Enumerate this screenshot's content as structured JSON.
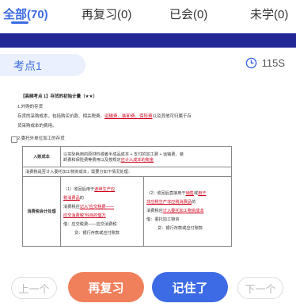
{
  "tabs": [
    {
      "label": "全部(70)",
      "active": true
    },
    {
      "label": "再复习(0)",
      "active": false
    },
    {
      "label": "已会(0)",
      "active": false
    },
    {
      "label": "未学(0)",
      "active": false
    }
  ],
  "point": {
    "label": "考点1",
    "timer": "115S"
  },
  "card": {
    "title": "【高频考点 1】存货的初始计量（★★）",
    "line1": "1.外购的存货",
    "line2_pre": "存货的采购成本，包括购买价款、相关税费、",
    "line2_red": "运输费、装卸费、保险费",
    "line2_post": "以及其他可归属于存",
    "line3": "货采购成本的费用。",
    "line4": "2.委托外单位加工的存货",
    "table": {
      "row1_head": "入账成本",
      "row1_a": "以实际耗用的原材料或者半成品成本 + 支付的加工费 + 运输费、装",
      "row1_b_pre": "卸费和保险费等费用以及按规定",
      "row1_b_red": "应计入成本的税金",
      "row2": "消费税是否计入委托加工物资成本，需要分如下情况处理：",
      "row3_head": "消费税会计处理",
      "left1_pre": "（1）收回后用于",
      "left1_red": "连续生产应",
      "left2_red": "税消费品",
      "left2_post": "的",
      "left3_pre": "消费税应",
      "left3_red": "记入“应交税费——",
      "left4_red": "应交消费税”科目的借方",
      "left5": "借：应交税费——应交消费税",
      "left6": "贷：银行存款或应付账款",
      "right1_pre": "（2）收回后直接用于",
      "right1_red": "销售",
      "right1_mid": "或",
      "right1_red2": "用于",
      "right2_red": "非应税生产非应税消费品",
      "right2_post": "的",
      "right3_pre": "消费税应",
      "right3_red": "计入委托加工物资成本",
      "right4": "借：委托加工物资",
      "right5": "贷：银行存款或应付账款"
    }
  },
  "buttons": {
    "prev": "上一个",
    "review": "再复习",
    "remember": "记住了",
    "next": "下一个"
  }
}
